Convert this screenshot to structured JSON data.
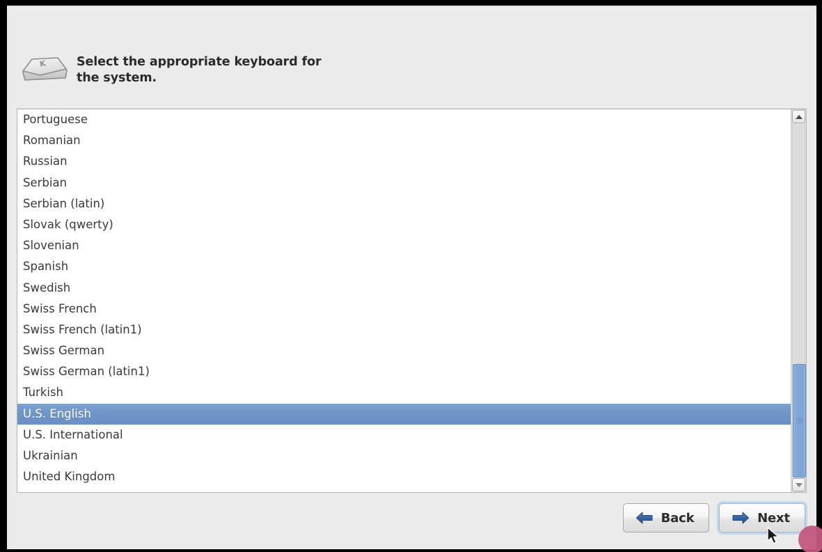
{
  "window": {
    "background_color": "#ebebeb",
    "frame_color": "#000000"
  },
  "header": {
    "icon": "keyboard-key-icon",
    "keycap_letter": "K",
    "title_line_1": "Select the appropriate keyboard for",
    "title_line_2": "the system.",
    "title_full": "Select the appropriate keyboard for the system."
  },
  "keyboard_list": {
    "selected_value": "U.S. English",
    "selection_color": "#6f94c6",
    "items": [
      {
        "label": "Portuguese",
        "selected": false
      },
      {
        "label": "Romanian",
        "selected": false
      },
      {
        "label": "Russian",
        "selected": false
      },
      {
        "label": "Serbian",
        "selected": false
      },
      {
        "label": "Serbian (latin)",
        "selected": false
      },
      {
        "label": "Slovak (qwerty)",
        "selected": false
      },
      {
        "label": "Slovenian",
        "selected": false
      },
      {
        "label": "Spanish",
        "selected": false
      },
      {
        "label": "Swedish",
        "selected": false
      },
      {
        "label": "Swiss French",
        "selected": false
      },
      {
        "label": "Swiss French (latin1)",
        "selected": false
      },
      {
        "label": "Swiss German",
        "selected": false
      },
      {
        "label": "Swiss German (latin1)",
        "selected": false
      },
      {
        "label": "Turkish",
        "selected": false
      },
      {
        "label": "U.S. English",
        "selected": true
      },
      {
        "label": "U.S. International",
        "selected": false
      },
      {
        "label": "Ukrainian",
        "selected": false
      },
      {
        "label": "United Kingdom",
        "selected": false
      }
    ]
  },
  "scrollbar": {
    "up_arrow": "chevron-up-icon",
    "down_arrow": "chevron-down-icon",
    "thumb_color": "#84a8d8",
    "thumb_top_pct": 68,
    "thumb_height_pct": 32
  },
  "buttons": {
    "back": {
      "label": "Back",
      "icon": "arrow-left-icon",
      "icon_color": "#2f62ab",
      "focused": false
    },
    "next": {
      "label": "Next",
      "icon": "arrow-right-icon",
      "icon_color": "#2f62ab",
      "focused": true
    }
  },
  "cursor": {
    "type": "arrow-pointer"
  },
  "edge_decoration": {
    "color": "#c4577f"
  }
}
